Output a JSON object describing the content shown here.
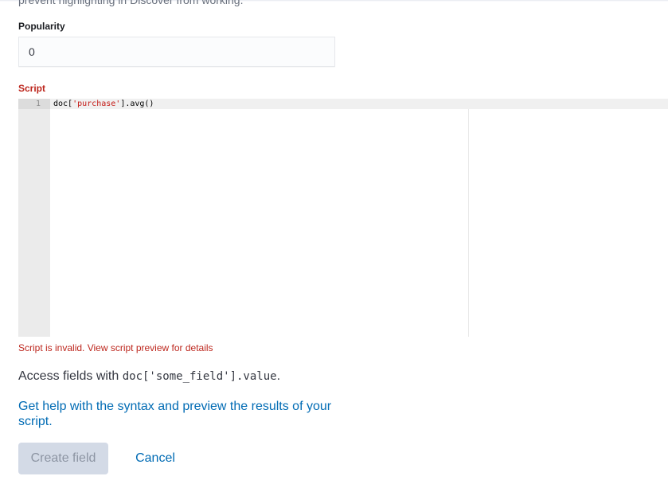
{
  "description_tail": "prevent highlighting in Discover from working.",
  "popularity": {
    "label": "Popularity",
    "value": "0"
  },
  "script": {
    "label": "Script",
    "line_number": "1",
    "code_prefix": "doc[",
    "code_string": "'purchase'",
    "code_suffix": "].avg()",
    "error": "Script is invalid. View script preview for details"
  },
  "help": {
    "access_prefix": "Access fields with ",
    "access_code": "doc['some_field'].value",
    "access_suffix": ".",
    "link_text": "Get help with the syntax and preview the results of your script."
  },
  "buttons": {
    "create_label": "Create field",
    "cancel_label": "Cancel"
  },
  "colors": {
    "danger": "#bd271e",
    "link": "#006bb4",
    "disabled_bg": "#d3dae6"
  }
}
